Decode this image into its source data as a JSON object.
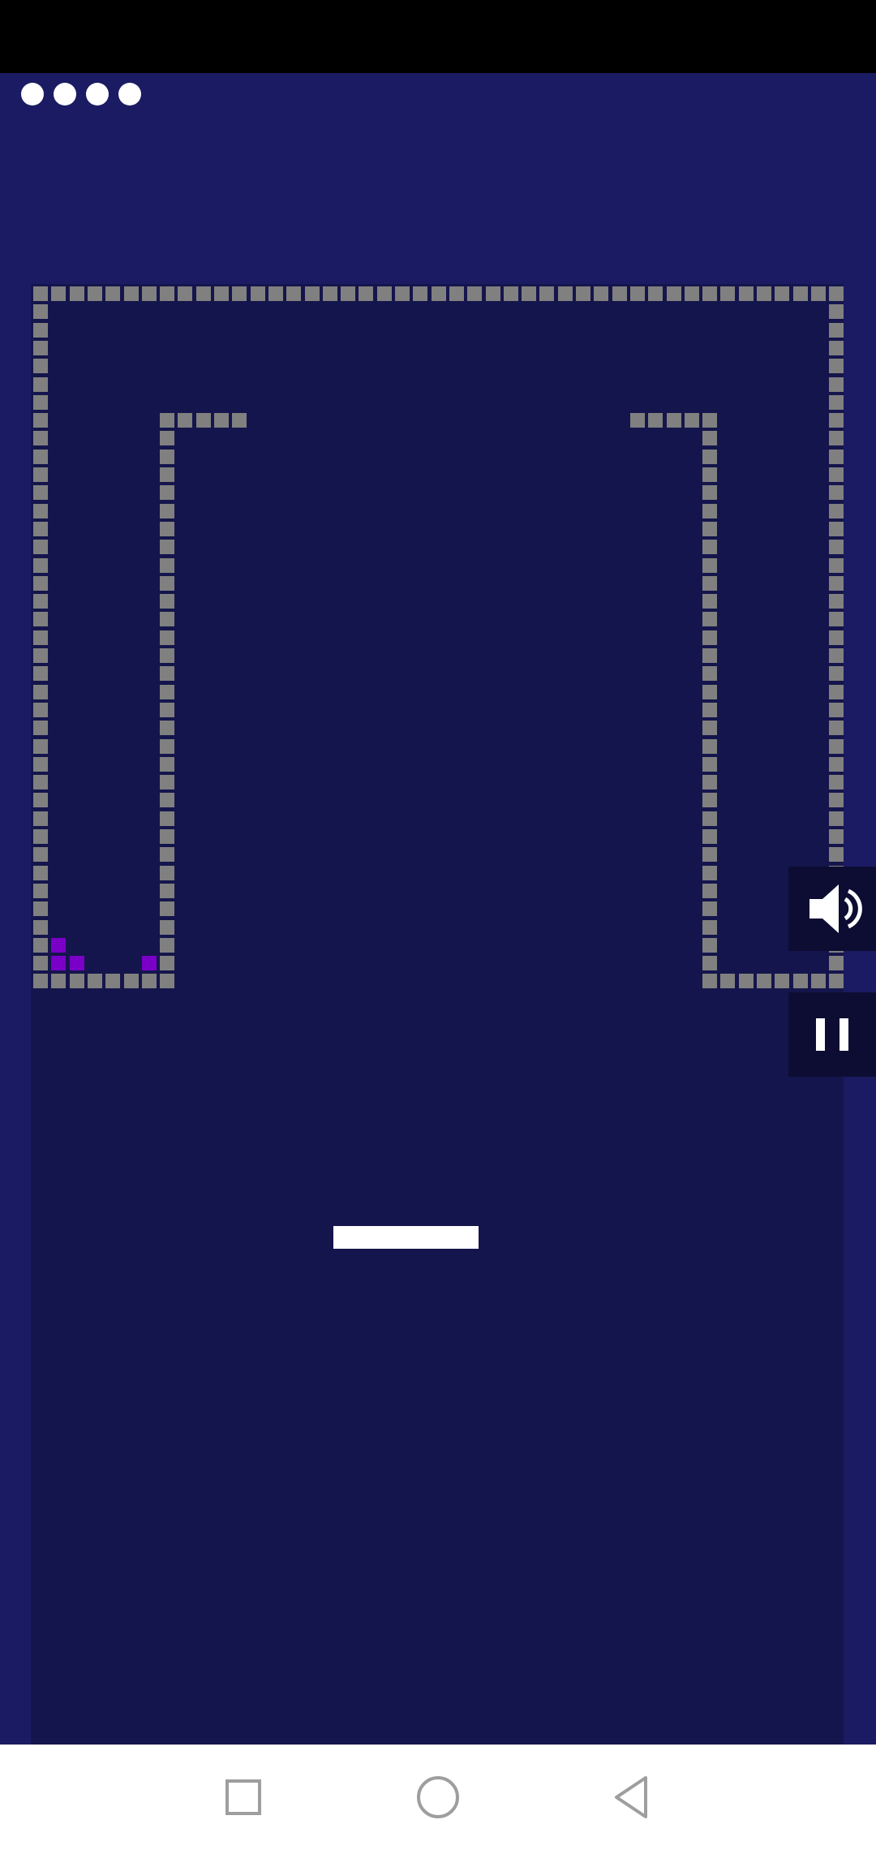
{
  "game": {
    "lives": 4,
    "colors": {
      "background": "#1b1b63",
      "playfield": "#15154d",
      "wall_brick": "#808080",
      "target_brick": "#7a00c8",
      "paddle": "#ffffff",
      "status_bar": "#000000",
      "nav_bar": "#ffffff"
    }
  },
  "controls": {
    "sound_icon": "speaker-volume-icon",
    "pause_icon": "pause-icon"
  },
  "nav": {
    "recents_icon": "square-recents-icon",
    "home_icon": "circle-home-icon",
    "back_icon": "triangle-back-icon"
  }
}
